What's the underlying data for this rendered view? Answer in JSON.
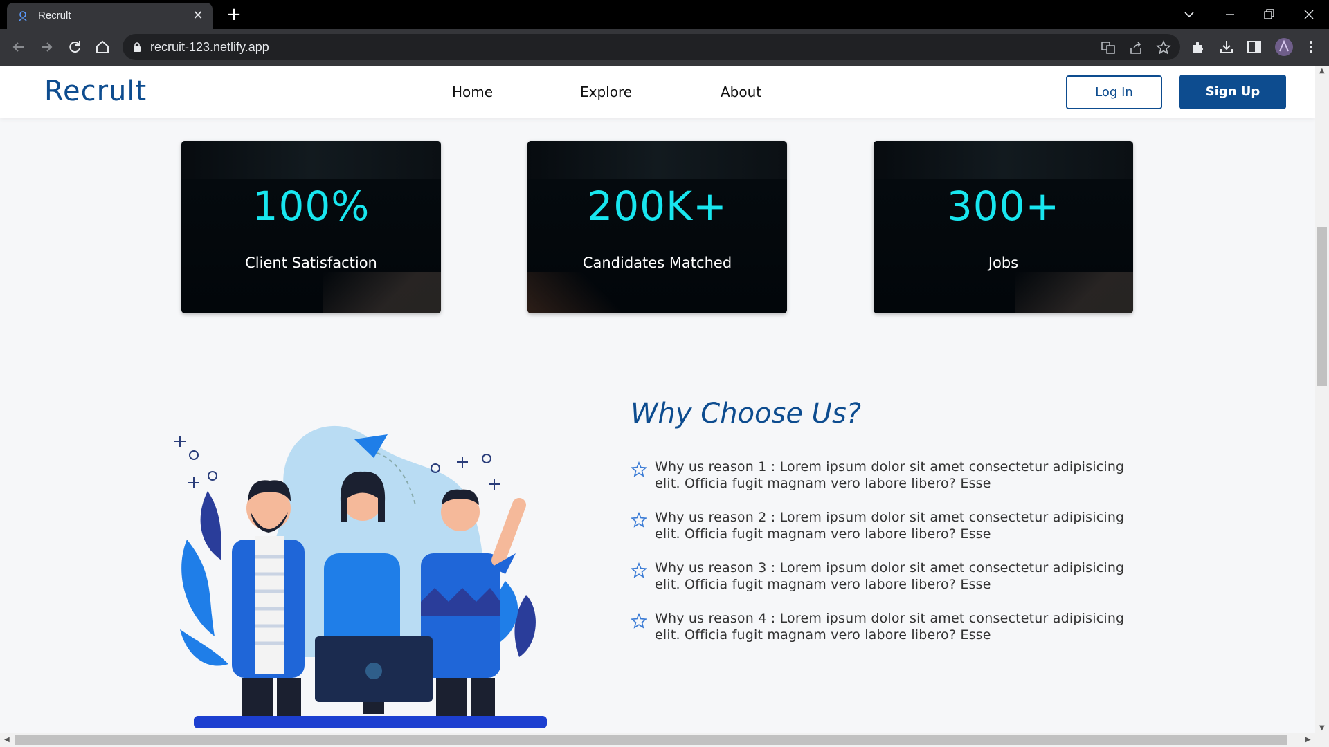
{
  "browser": {
    "tab_title": "Recrult",
    "tab_close": "✕",
    "new_tab": "+",
    "url": "recruit-123.netlify.app"
  },
  "site": {
    "logo": "Recrult",
    "nav": [
      "Home",
      "Explore",
      "About"
    ],
    "login_label": "Log In",
    "signup_label": "Sign Up"
  },
  "stats": [
    {
      "value": "100%",
      "label": "Client Satisfaction"
    },
    {
      "value": "200K+",
      "label": "Candidates Matched"
    },
    {
      "value": "300+",
      "label": "Jobs"
    }
  ],
  "why": {
    "title": "Why Choose Us?",
    "reasons": [
      "Why us reason 1 : Lorem ipsum dolor sit amet consectetur adipisicing elit. Officia fugit magnam vero labore libero? Esse",
      "Why us reason 2 : Lorem ipsum dolor sit amet consectetur adipisicing elit. Officia fugit magnam vero labore libero? Esse",
      "Why us reason 3 : Lorem ipsum dolor sit amet consectetur adipisicing elit. Officia fugit magnam vero labore libero? Esse",
      "Why us reason 4 : Lorem ipsum dolor sit amet consectetur adipisicing elit. Officia fugit magnam vero labore libero? Esse"
    ]
  },
  "colors": {
    "brand": "#0d4c8f",
    "stat_number": "#18e6ef",
    "star": "#3a7bd5"
  },
  "icons": [
    "back-icon",
    "forward-icon",
    "reload-icon",
    "home-icon",
    "lock-icon",
    "translate-icon",
    "share-icon",
    "bookmark-star-icon",
    "extensions-icon",
    "download-icon",
    "side-panel-icon",
    "profile-avatar",
    "menu-icon",
    "star-icon"
  ]
}
